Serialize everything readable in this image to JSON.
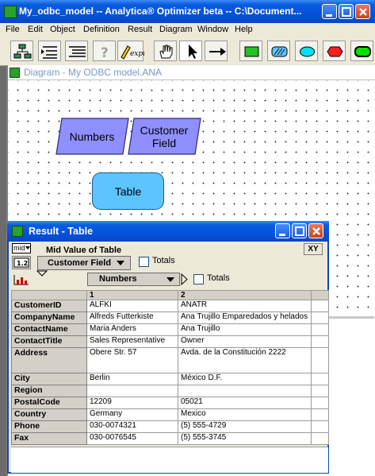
{
  "app": {
    "title": "My_odbc_model -- Analytica® Optimizer beta -- C:\\Document...",
    "menu": [
      "File",
      "Edit",
      "Object",
      "Definition",
      "Result",
      "Diagram",
      "Window",
      "Help"
    ]
  },
  "toolbar": {
    "expr_label": "expr",
    "tools": [
      "outline-tool-icon",
      "hierarchy-tool-icon",
      "list-tool-icon",
      "help-tool-icon",
      "expression-tool-icon",
      "hand-tool-icon",
      "arrow-pointer-icon",
      "arrow-connect-icon",
      "decision-node-icon",
      "variable-node-icon",
      "chance-node-icon",
      "objective-node-icon",
      "module-node-icon"
    ]
  },
  "diagram": {
    "title": "Diagram - My ODBC model.ANA",
    "nodes": {
      "numbers": "Numbers",
      "customer_field": "Customer Field",
      "table": "Table"
    }
  },
  "result": {
    "title": "Result - Table",
    "mid_label": "mid",
    "heading": "Mid Value of Table",
    "xy_label": "XY",
    "row_index": "Customer Field",
    "col_index": "Numbers",
    "totals_label": "Totals",
    "col_numbers": [
      "1",
      "2"
    ],
    "rows": [
      [
        "CustomerID",
        "ALFKI",
        "ANATR"
      ],
      [
        "CompanyName",
        "Alfreds Futterkiste",
        "Ana Trujillo Emparedados y helados"
      ],
      [
        "ContactName",
        "Maria Anders",
        "Ana Trujillo"
      ],
      [
        "ContactTitle",
        "Sales Representative",
        "Owner"
      ],
      [
        "Address",
        "Obere Str. 57",
        "Avda. de la Constitución 2222"
      ],
      [
        "City",
        "Berlin",
        "México D.F."
      ],
      [
        "Region",
        "",
        ""
      ],
      [
        "PostalCode",
        "12209",
        "05021"
      ],
      [
        "Country",
        "Germany",
        "Mexico"
      ],
      [
        "Phone",
        "030-0074321",
        "(5) 555-4729"
      ],
      [
        "Fax",
        "030-0076545",
        "(5) 555-3745"
      ]
    ]
  },
  "colors": {
    "node_fill": "#8f8fff",
    "table_node_fill": "#5cc4ff",
    "titlebar": "#0a5ce0"
  }
}
